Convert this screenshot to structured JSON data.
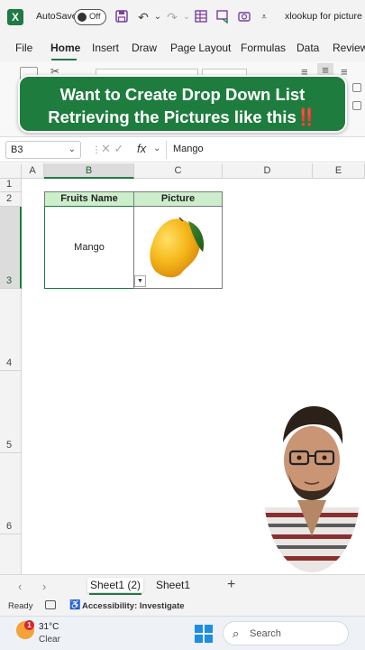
{
  "titlebar": {
    "app_icon": "X",
    "autosave_label": "AutoSave",
    "autosave_state": "Off",
    "doc_title": "xlookup for picture",
    "icons": [
      "save-icon",
      "undo-icon",
      "redo-icon",
      "form-icon",
      "comment-icon",
      "camera-icon",
      "customize-icon"
    ]
  },
  "menu": {
    "items": [
      "File",
      "Home",
      "Insert",
      "Draw",
      "Page Layout",
      "Formulas",
      "Data",
      "Review"
    ],
    "active": "Home"
  },
  "promo": {
    "line1": "Want to Create Drop Down List",
    "line2": "Retrieving the Pictures like this",
    "line2_suffix": "‼️"
  },
  "formula_bar": {
    "name_box": "B3",
    "fx_label": "fx",
    "value": "Mango"
  },
  "grid": {
    "columns": [
      "A",
      "B",
      "C",
      "D",
      "E"
    ],
    "rows": [
      "1",
      "2",
      "3",
      "4",
      "5",
      "6"
    ],
    "selected_column": "B",
    "selected_row": "3"
  },
  "table": {
    "headers": [
      "Fruits Name",
      "Picture"
    ],
    "fruit": "Mango"
  },
  "sheets": {
    "tabs": [
      "Sheet1 (2)",
      "Sheet1"
    ],
    "active": "Sheet1 (2)",
    "add_label": "+"
  },
  "status": {
    "ready": "Ready",
    "accessibility": "Accessibility: Investigate"
  },
  "taskbar": {
    "weather_badge": "1",
    "temperature": "31°C",
    "condition": "Clear",
    "search_placeholder": "Search"
  },
  "colors": {
    "excel_green": "#1e7d3e",
    "header_fill": "#cdeecb",
    "accent_red": "#e8343a"
  }
}
